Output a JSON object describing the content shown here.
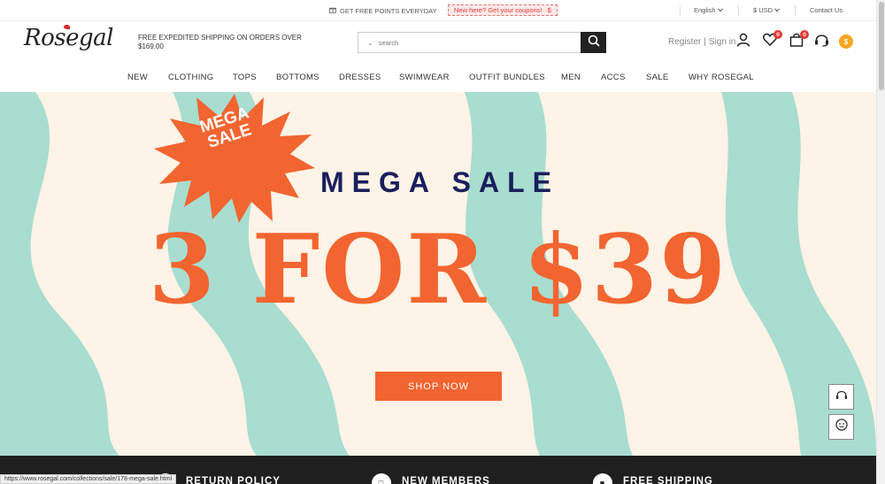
{
  "topbar": {
    "promo": "GET FREE POINTS EVERYDAY",
    "coupon": "New here? Get your coupons!",
    "coupon_icon": "$",
    "language": "English",
    "currency": "$ USD",
    "contact": "Contact Us"
  },
  "header": {
    "logo": "Rosegal",
    "shipping_line1": "FREE EXPEDITED SHIPPING ON ORDERS OVER",
    "shipping_line2": "$169.00",
    "search_placeholder": "search",
    "register": "Register",
    "divider": "|",
    "signin": "Sign in",
    "wishlist_count": "0",
    "cart_count": "0",
    "points_symbol": "$"
  },
  "nav": {
    "items": [
      "NEW",
      "CLOTHING",
      "TOPS",
      "BOTTOMS",
      "DRESSES",
      "SWIMWEAR",
      "OUTFIT BUNDLES",
      "MEN",
      "ACCS",
      "SALE",
      "WHY ROSEGAL"
    ]
  },
  "hero": {
    "burst_line1": "MEGA",
    "burst_line2": "SALE",
    "title": "MEGA SALE",
    "offer": "3 FOR $39",
    "cta": "SHOP NOW",
    "colors": {
      "background": "#fdf3e6",
      "wave": "#a8ddd0",
      "accent": "#f26530",
      "title": "#1a1f5c"
    }
  },
  "features": {
    "return_policy": "RETURN POLICY",
    "new_members": "NEW MEMBERS",
    "free_shipping": "FREE SHIPPING"
  },
  "status_bar": {
    "url": "https://www.rosegal.com/collections/sale/178-mega-sale.html"
  }
}
